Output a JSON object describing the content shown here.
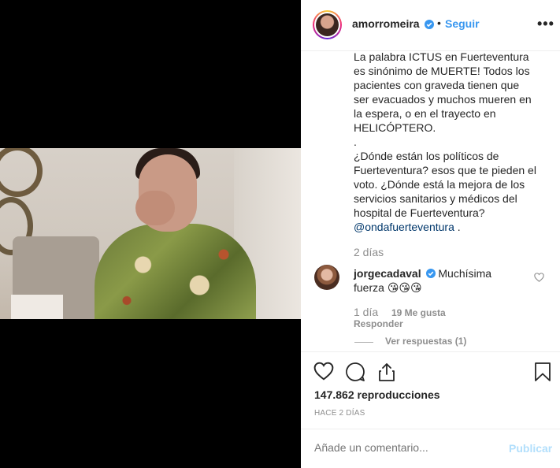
{
  "post": {
    "header": {
      "username": "amorromeira",
      "separator": "•",
      "follow_label": "Seguir",
      "more_label": "•••"
    },
    "caption_lines": [
      "La palabra ICTUS en Fuerteventura",
      "es sinónimo de MUERTE! Todos los",
      "pacientes con graveda tienen que",
      "ser evacuados y muchos mueren en",
      "la espera, o en el trayecto en",
      "HELICÓPTERO.",
      ".",
      "¿Dónde están los políticos de",
      "Fuerteventura? esos que te pieden el",
      "voto. ¿Dónde está la mejora de los",
      "servicios sanitarios y médicos del",
      "hospital de Fuerteventura?"
    ],
    "caption_mention": "@ondafuerteventura",
    "caption_tail": " .",
    "caption_time": "2 días",
    "comment": {
      "username": "jorgecadaval",
      "text": "Muchísima",
      "text_line2": "fuerza",
      "emojis": [
        "😘",
        "😘",
        "😘"
      ],
      "time": "1 día",
      "likes": "19 Me gusta",
      "reply_label": "Responder",
      "view_replies": "Ver respuestas (1)"
    },
    "stats": {
      "views": "147.862 reproducciones",
      "posted": "HACE 2 DÍAS"
    },
    "add_comment": {
      "placeholder": "Añade un comentario...",
      "publish_label": "Publicar"
    }
  },
  "colors": {
    "accent": "#3897f0",
    "publish_disabled": "#b2dffc",
    "secondary_text": "#8e8e8e",
    "primary_text": "#262626"
  },
  "icons": [
    "heart-icon",
    "comment-icon",
    "share-icon",
    "bookmark-icon",
    "verified-badge-icon",
    "more-options-icon"
  ]
}
